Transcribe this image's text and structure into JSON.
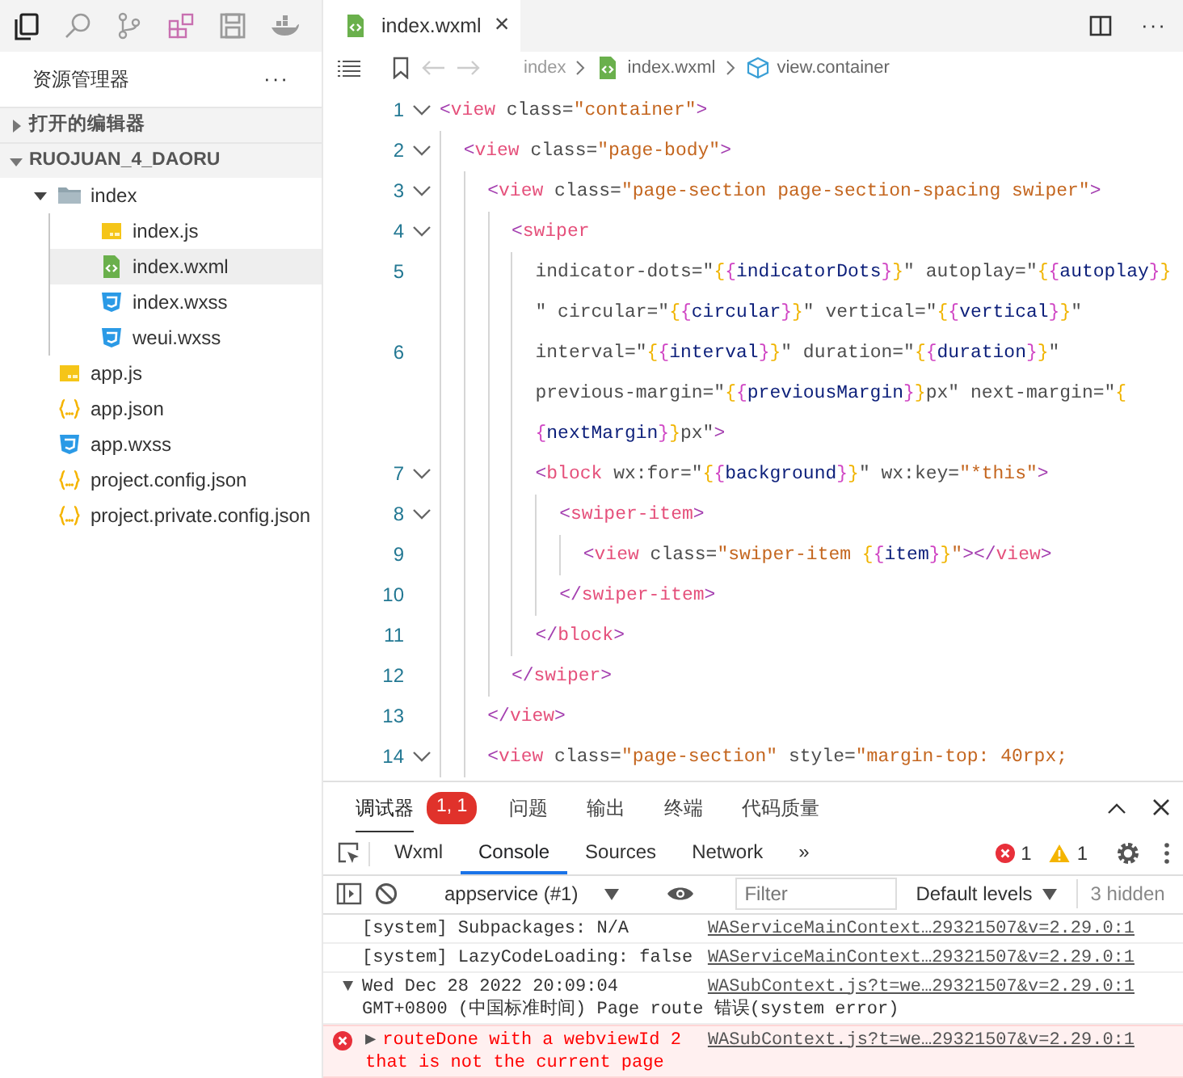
{
  "activity_bar": [
    {
      "kind": "files",
      "selected": true
    },
    {
      "kind": "search",
      "selected": false
    },
    {
      "kind": "branch",
      "selected": false
    },
    {
      "kind": "extensions",
      "selected": false
    },
    {
      "kind": "save",
      "selected": false
    },
    {
      "kind": "whale",
      "selected": false
    }
  ],
  "explorer": {
    "title": "资源管理器",
    "more": "···",
    "sections": [
      {
        "label": "打开的编辑器",
        "expanded": false
      },
      {
        "label": "RUOJUAN_4_DAORU",
        "expanded": true,
        "children": [
          {
            "name": "index",
            "kind": "folder",
            "expanded": true,
            "selected": false,
            "children": [
              {
                "name": "index.js",
                "kind": "js",
                "selected": false
              },
              {
                "name": "index.wxml",
                "kind": "wxml",
                "selected": true
              },
              {
                "name": "index.wxss",
                "kind": "wxss",
                "selected": false
              },
              {
                "name": "weui.wxss",
                "kind": "wxss",
                "selected": false
              }
            ]
          },
          {
            "name": "app.js",
            "kind": "js",
            "selected": false
          },
          {
            "name": "app.json",
            "kind": "json",
            "selected": false
          },
          {
            "name": "app.wxss",
            "kind": "wxss",
            "selected": false
          },
          {
            "name": "project.config.json",
            "kind": "json",
            "selected": false
          },
          {
            "name": "project.private.config.json",
            "kind": "json",
            "selected": false
          }
        ]
      }
    ]
  },
  "editor": {
    "tab": {
      "label": "index.wxml",
      "kind": "wxml",
      "close": "×"
    },
    "more": "···",
    "breadcrumbs": [
      {
        "label": "index",
        "kind": "folder"
      },
      {
        "label": "index.wxml",
        "kind": "wxml"
      },
      {
        "label": "view.container",
        "kind": "element"
      }
    ],
    "lines": [
      {
        "number": "1",
        "foldable": true,
        "rows": [
          {
            "segments": [
              {
                "kind": "bracket",
                "text": "<"
              },
              {
                "kind": "tag",
                "text": "view"
              },
              {
                "kind": "attr",
                "text": " class="
              },
              {
                "kind": "string",
                "text": "\"container\""
              },
              {
                "kind": "bracket",
                "text": ">"
              }
            ]
          }
        ]
      },
      {
        "number": "2",
        "foldable": true,
        "rows": [
          {
            "segments": [
              {
                "kind": "bracket",
                "text": "  <"
              },
              {
                "kind": "tag",
                "text": "view"
              },
              {
                "kind": "attr",
                "text": " class="
              },
              {
                "kind": "string",
                "text": "\"page-body\""
              },
              {
                "kind": "bracket",
                "text": ">"
              }
            ]
          }
        ]
      },
      {
        "number": "3",
        "foldable": true,
        "rows": [
          {
            "segments": [
              {
                "kind": "bracket",
                "text": "    <"
              },
              {
                "kind": "tag",
                "text": "view"
              },
              {
                "kind": "attr",
                "text": " class="
              },
              {
                "kind": "string",
                "text": "\"page-section page-section-spacing swiper\""
              },
              {
                "kind": "bracket",
                "text": ">"
              }
            ]
          }
        ]
      },
      {
        "number": "4",
        "foldable": true,
        "rows": [
          {
            "segments": [
              {
                "kind": "bracket",
                "text": "      <"
              },
              {
                "kind": "tag",
                "text": "swiper"
              }
            ]
          }
        ]
      },
      {
        "number": "5",
        "foldable": false,
        "rows": [
          {
            "segments": [
              {
                "kind": "attr",
                "text": "        indicator-dots="
              },
              {
                "kind": "quote",
                "text": "\""
              },
              {
                "kind": "brace_outer",
                "text": "{"
              },
              {
                "kind": "brace_inner",
                "text": "{"
              },
              {
                "kind": "variable",
                "text": "indicatorDots"
              },
              {
                "kind": "brace_inner",
                "text": "}"
              },
              {
                "kind": "brace_outer",
                "text": "}"
              },
              {
                "kind": "quote",
                "text": "\""
              },
              {
                "kind": "attr",
                "text": " autoplay="
              },
              {
                "kind": "quote",
                "text": "\""
              },
              {
                "kind": "brace_outer",
                "text": "{"
              },
              {
                "kind": "brace_inner",
                "text": "{"
              },
              {
                "kind": "variable",
                "text": "autoplay"
              },
              {
                "kind": "brace_inner",
                "text": "}"
              },
              {
                "kind": "brace_outer",
                "text": "}"
              }
            ]
          },
          {
            "segments": [
              {
                "kind": "quote",
                "text": "        \""
              },
              {
                "kind": "attr",
                "text": " circular="
              },
              {
                "kind": "quote",
                "text": "\""
              },
              {
                "kind": "brace_outer",
                "text": "{"
              },
              {
                "kind": "brace_inner",
                "text": "{"
              },
              {
                "kind": "variable",
                "text": "circular"
              },
              {
                "kind": "brace_inner",
                "text": "}"
              },
              {
                "kind": "brace_outer",
                "text": "}"
              },
              {
                "kind": "quote",
                "text": "\""
              },
              {
                "kind": "attr",
                "text": " vertical="
              },
              {
                "kind": "quote",
                "text": "\""
              },
              {
                "kind": "brace_outer",
                "text": "{"
              },
              {
                "kind": "brace_inner",
                "text": "{"
              },
              {
                "kind": "variable",
                "text": "vertical"
              },
              {
                "kind": "brace_inner",
                "text": "}"
              },
              {
                "kind": "brace_outer",
                "text": "}"
              },
              {
                "kind": "quote",
                "text": "\""
              }
            ]
          }
        ]
      },
      {
        "number": "6",
        "foldable": false,
        "rows": [
          {
            "segments": [
              {
                "kind": "attr",
                "text": "        interval="
              },
              {
                "kind": "quote",
                "text": "\""
              },
              {
                "kind": "brace_outer",
                "text": "{"
              },
              {
                "kind": "brace_inner",
                "text": "{"
              },
              {
                "kind": "variable",
                "text": "interval"
              },
              {
                "kind": "brace_inner",
                "text": "}"
              },
              {
                "kind": "brace_outer",
                "text": "}"
              },
              {
                "kind": "quote",
                "text": "\""
              },
              {
                "kind": "attr",
                "text": " duration="
              },
              {
                "kind": "quote",
                "text": "\""
              },
              {
                "kind": "brace_outer",
                "text": "{"
              },
              {
                "kind": "brace_inner",
                "text": "{"
              },
              {
                "kind": "variable",
                "text": "duration"
              },
              {
                "kind": "brace_inner",
                "text": "}"
              },
              {
                "kind": "brace_outer",
                "text": "}"
              },
              {
                "kind": "quote",
                "text": "\""
              }
            ]
          },
          {
            "segments": [
              {
                "kind": "attr",
                "text": "        previous-margin="
              },
              {
                "kind": "quote",
                "text": "\""
              },
              {
                "kind": "brace_outer",
                "text": "{"
              },
              {
                "kind": "brace_inner",
                "text": "{"
              },
              {
                "kind": "variable",
                "text": "previousMargin"
              },
              {
                "kind": "brace_inner",
                "text": "}"
              },
              {
                "kind": "brace_outer",
                "text": "}"
              },
              {
                "kind": "attr",
                "text": "px"
              },
              {
                "kind": "quote",
                "text": "\""
              },
              {
                "kind": "attr",
                "text": " next-margin="
              },
              {
                "kind": "quote",
                "text": "\""
              },
              {
                "kind": "brace_outer",
                "text": "{"
              }
            ]
          },
          {
            "segments": [
              {
                "kind": "brace_inner",
                "text": "        {"
              },
              {
                "kind": "variable",
                "text": "nextMargin"
              },
              {
                "kind": "brace_inner",
                "text": "}"
              },
              {
                "kind": "brace_outer",
                "text": "}"
              },
              {
                "kind": "attr",
                "text": "px"
              },
              {
                "kind": "quote",
                "text": "\""
              },
              {
                "kind": "bracket",
                "text": ">"
              }
            ]
          }
        ]
      },
      {
        "number": "7",
        "foldable": true,
        "rows": [
          {
            "segments": [
              {
                "kind": "bracket",
                "text": "        <"
              },
              {
                "kind": "tag",
                "text": "block"
              },
              {
                "kind": "attr",
                "text": " wx:for="
              },
              {
                "kind": "quote",
                "text": "\""
              },
              {
                "kind": "brace_outer",
                "text": "{"
              },
              {
                "kind": "brace_inner",
                "text": "{"
              },
              {
                "kind": "variable",
                "text": "background"
              },
              {
                "kind": "brace_inner",
                "text": "}"
              },
              {
                "kind": "brace_outer",
                "text": "}"
              },
              {
                "kind": "quote",
                "text": "\""
              },
              {
                "kind": "attr",
                "text": " wx:key="
              },
              {
                "kind": "string",
                "text": "\"*this\""
              },
              {
                "kind": "bracket",
                "text": ">"
              }
            ]
          }
        ]
      },
      {
        "number": "8",
        "foldable": true,
        "rows": [
          {
            "segments": [
              {
                "kind": "bracket",
                "text": "          <"
              },
              {
                "kind": "tag",
                "text": "swiper-item"
              },
              {
                "kind": "bracket",
                "text": ">"
              }
            ]
          }
        ]
      },
      {
        "number": "9",
        "foldable": false,
        "rows": [
          {
            "segments": [
              {
                "kind": "bracket",
                "text": "            <"
              },
              {
                "kind": "tag",
                "text": "view"
              },
              {
                "kind": "attr",
                "text": " class="
              },
              {
                "kind": "string",
                "text": "\"swiper-item "
              },
              {
                "kind": "brace_outer",
                "text": "{"
              },
              {
                "kind": "brace_inner",
                "text": "{"
              },
              {
                "kind": "variable",
                "text": "item"
              },
              {
                "kind": "brace_inner",
                "text": "}"
              },
              {
                "kind": "brace_outer",
                "text": "}"
              },
              {
                "kind": "string",
                "text": "\""
              },
              {
                "kind": "bracket",
                "text": "></"
              },
              {
                "kind": "tag",
                "text": "view"
              },
              {
                "kind": "bracket",
                "text": ">"
              }
            ]
          }
        ]
      },
      {
        "number": "10",
        "foldable": false,
        "rows": [
          {
            "segments": [
              {
                "kind": "bracket",
                "text": "          </"
              },
              {
                "kind": "tag",
                "text": "swiper-item"
              },
              {
                "kind": "bracket",
                "text": ">"
              }
            ]
          }
        ]
      },
      {
        "number": "11",
        "foldable": false,
        "rows": [
          {
            "segments": [
              {
                "kind": "bracket",
                "text": "        </"
              },
              {
                "kind": "tag",
                "text": "block"
              },
              {
                "kind": "bracket",
                "text": ">"
              }
            ]
          }
        ]
      },
      {
        "number": "12",
        "foldable": false,
        "rows": [
          {
            "segments": [
              {
                "kind": "bracket",
                "text": "      </"
              },
              {
                "kind": "tag",
                "text": "swiper"
              },
              {
                "kind": "bracket",
                "text": ">"
              }
            ]
          }
        ]
      },
      {
        "number": "13",
        "foldable": false,
        "rows": [
          {
            "segments": [
              {
                "kind": "bracket",
                "text": "    </"
              },
              {
                "kind": "tag",
                "text": "view"
              },
              {
                "kind": "bracket",
                "text": ">"
              }
            ]
          }
        ]
      },
      {
        "number": "14",
        "foldable": true,
        "rows": [
          {
            "segments": [
              {
                "kind": "bracket",
                "text": "    <"
              },
              {
                "kind": "tag",
                "text": "view"
              },
              {
                "kind": "attr",
                "text": " class="
              },
              {
                "kind": "string",
                "text": "\"page-section\""
              },
              {
                "kind": "attr",
                "text": " style="
              },
              {
                "kind": "string",
                "text": "\"margin-top: 40rpx;"
              }
            ]
          }
        ]
      }
    ]
  },
  "panel": {
    "tabs": [
      {
        "label": "调试器",
        "selected": true,
        "badge": "1, 1"
      },
      {
        "label": "问题",
        "selected": false
      },
      {
        "label": "输出",
        "selected": false
      },
      {
        "label": "终端",
        "selected": false
      },
      {
        "label": "代码质量",
        "selected": false
      }
    ]
  },
  "devtools": {
    "tabs": [
      {
        "label": "Wxml",
        "selected": false
      },
      {
        "label": "Console",
        "selected": true
      },
      {
        "label": "Sources",
        "selected": false
      },
      {
        "label": "Network",
        "selected": false
      }
    ],
    "overflow": "»",
    "errors": "1",
    "warnings": "1"
  },
  "console": {
    "context": "appservice (#1)",
    "filter_placeholder": "Filter",
    "levels": "Default levels",
    "hidden": "3 hidden",
    "messages": [
      {
        "kind": "log",
        "lines": [
          "[system] Subpackages: N/A"
        ],
        "source": "WAServiceMainContext…29321507&v=2.29.0:1"
      },
      {
        "kind": "log",
        "lines": [
          "[system] LazyCodeLoading: false"
        ],
        "source": "WAServiceMainContext…29321507&v=2.29.0:1"
      },
      {
        "kind": "group",
        "expander": "▼",
        "lines": [
          "Wed Dec 28 2022 20:09:04",
          "GMT+0800 (中国标准时间) Page route 错误(system error)"
        ],
        "source": "WASubContext.js?t=we…29321507&v=2.29.0:1"
      },
      {
        "kind": "error",
        "expander": "▶",
        "lines": [
          "routeDone with a webviewId 2",
          "that is not the current page"
        ],
        "source": "WASubContext.js?t=we…29321507&v=2.29.0:1"
      }
    ]
  }
}
